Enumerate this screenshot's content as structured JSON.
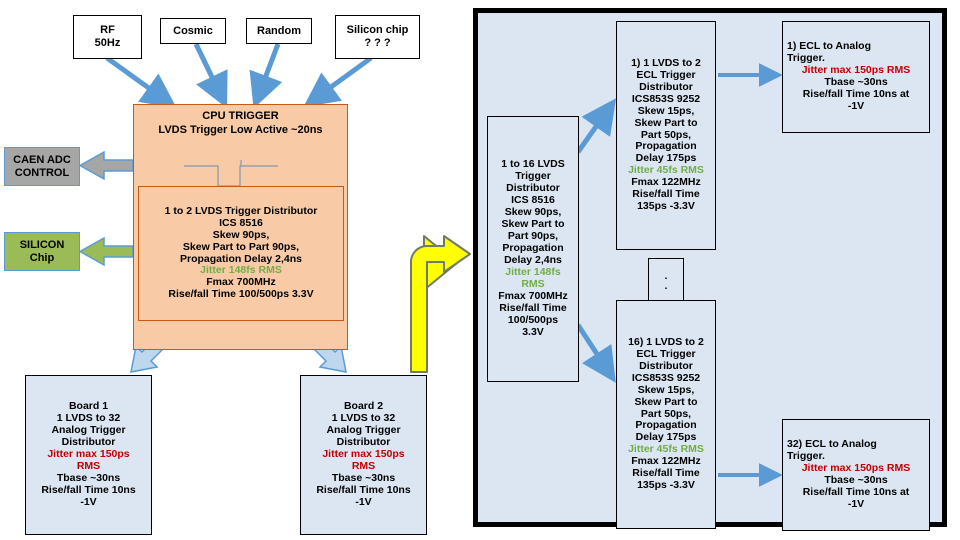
{
  "diagram": {
    "title": "Trigger Distribution Block Diagram",
    "colors": {
      "peach_fill": "#F8CBA6",
      "peach_border": "#C55A11",
      "blue_fill": "#DCE6F2",
      "gray_fill": "#A6A6A6",
      "green_fill": "#9BBB59",
      "arrow_blue": "#5B9BD5",
      "arrow_yellow": "#FFFF00",
      "arrow_outline": "#6E7B6B",
      "jitter_red": "#C00000",
      "jitter_green": "#70AD47",
      "panel_border": "#000000"
    },
    "sources": [
      {
        "name": "rf-source",
        "lines": "RF\n50Hz"
      },
      {
        "name": "cosmic-source",
        "lines": "Cosmic"
      },
      {
        "name": "random-source",
        "lines": "Random"
      },
      {
        "name": "silicon-chip-source",
        "lines": "Silicon chip\n? ? ?"
      }
    ],
    "cpu_trigger": {
      "line1": "CPU TRIGGER",
      "line2": "LVDS Trigger Low Active ~20ns",
      "waveform_name": "low-active-pulse-waveform"
    },
    "lvds_1to2": {
      "l1": "1 to 2 LVDS Trigger Distributor",
      "l2": "ICS 8516",
      "l3": "Skew 90ps,",
      "l4": "Skew Part to Part 90ps,",
      "l5": "Propagation Delay 2,4ns",
      "l6": "Jitter 148fs RMS",
      "l7": "Fmax 700MHz",
      "l8": "Rise/fall Time 100/500ps 3.3V"
    },
    "caen": {
      "lines": "CAEN ADC\nCONTROL"
    },
    "silicon": {
      "lines": "SILICON\nChip"
    },
    "board1": {
      "l1": "Board 1",
      "l2": "1 LVDS to 32",
      "l3": "Analog Trigger",
      "l4": "Distributor",
      "l5": "Jitter max 150ps",
      "l6": "RMS",
      "l7": "Tbase ~30ns",
      "l8": "Rise/fall Time 10ns",
      "l9": "-1V"
    },
    "board2": {
      "l1": "Board 2",
      "l2": "1 LVDS to 32",
      "l3": "Analog Trigger",
      "l4": "Distributor",
      "l5": "Jitter max 150ps",
      "l6": "RMS",
      "l7": "Tbase ~30ns",
      "l8": "Rise/fall Time 10ns",
      "l9": "-1V"
    },
    "lvds_1to16": {
      "l1": "1 to 16 LVDS",
      "l2": "Trigger",
      "l3": "Distributor",
      "l4": "ICS 8516",
      "l5": "Skew 90ps,",
      "l6": "Skew Part to",
      "l7": "Part 90ps,",
      "l8": "Propagation",
      "l9": "Delay 2,4ns",
      "l10": "Jitter 148fs",
      "l11": "RMS",
      "l12": "Fmax 700MHz",
      "l13": "Rise/fall Time",
      "l14": "100/500ps",
      "l15": "3.3V"
    },
    "ecl_first": {
      "l1": "1) 1 LVDS to 2",
      "l2": "ECL Trigger",
      "l3": "Distributor",
      "l4": "ICS853S 9252",
      "l5": "Skew 15ps,",
      "l6": "Skew Part to",
      "l7": "Part 50ps,",
      "l8": "Propagation",
      "l9": "Delay 175ps",
      "l10": "Jitter 45fs RMS",
      "l11": "Fmax 122MHz",
      "l12": "Rise/fall Time",
      "l13": "135ps -3.3V"
    },
    "ecl_last": {
      "l1": "16) 1 LVDS to 2",
      "l2": "ECL Trigger",
      "l3": "Distributor",
      "l4": "ICS853S 9252",
      "l5": "Skew 15ps,",
      "l6": "Skew Part to",
      "l7": "Part 50ps,",
      "l8": "Propagation",
      "l9": "Delay 175ps",
      "l10": "Jitter 45fs RMS",
      "l11": "Fmax 122MHz",
      "l12": "Rise/fall Time",
      "l13": "135ps -3.3V"
    },
    "ellipsis": {
      "dots": ".\n."
    },
    "analog_first": {
      "l1": "1) ECL to Analog",
      "l2": "Trigger.",
      "l3": "Jitter max 150ps RMS",
      "l4": "Tbase ~30ns",
      "l5": "Rise/fall Time 10ns at",
      "l6": "-1V"
    },
    "analog_last": {
      "l1": "32) ECL to Analog",
      "l2": "Trigger.",
      "l3": "Jitter max 150ps RMS",
      "l4": "Tbase ~30ns",
      "l5": "Rise/fall Time 10ns at",
      "l6": "-1V"
    }
  }
}
